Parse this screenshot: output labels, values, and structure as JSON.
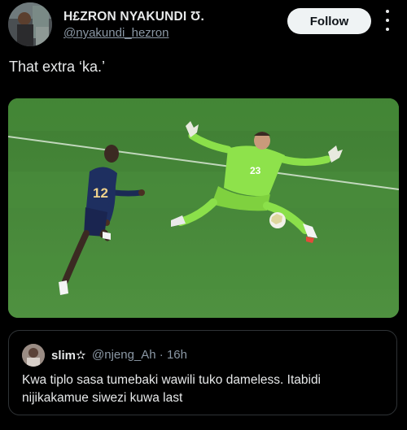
{
  "author": {
    "name": "H£ZRON NYAKUNDI Ʊ.",
    "handle": "@nyakundi_hezron"
  },
  "actions": {
    "follow_label": "Follow",
    "more_icon": "more-vertical-icon"
  },
  "tweet": {
    "text": "That extra ‘ka.’"
  },
  "media": {
    "player_number": "23",
    "attacker_number": "12"
  },
  "quoted": {
    "name": "slim✫",
    "handle_time": "@njeng_Ah · 16h",
    "text": "Kwa tiplo sasa tumebaki wawili tuko dameless. Itabidi nijikakamue siwezi kuwa last"
  }
}
